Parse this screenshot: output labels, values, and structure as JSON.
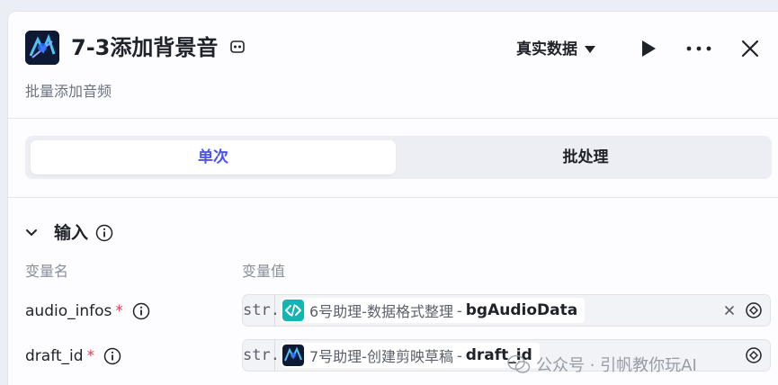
{
  "header": {
    "title": "7-3添加背景音",
    "subtitle": "批量添加音频",
    "mode_label": "真实数据"
  },
  "tabs": [
    {
      "label": "单次",
      "active": true
    },
    {
      "label": "批处理",
      "active": false
    }
  ],
  "inputs_section": {
    "title": "输入",
    "col_name": "变量名",
    "col_value": "变量值",
    "rows": [
      {
        "name": "audio_infos",
        "required_mark": "*",
        "type": "str.",
        "node": "6号助理-数据格式整理",
        "separator": "-",
        "variable": "bgAudioData",
        "icon": "code-icon"
      },
      {
        "name": "draft_id",
        "required_mark": "*",
        "type": "str.",
        "node": "7号助理-创建剪映草稿",
        "separator": "-",
        "variable": "draft_id",
        "icon": "app-logo-icon"
      }
    ]
  },
  "watermark": {
    "text": "公众号 · 引帆教你玩AI"
  },
  "colors": {
    "accent": "#4d53e8",
    "required": "#e8384f",
    "code_icon_bg": "#13b5b1"
  }
}
